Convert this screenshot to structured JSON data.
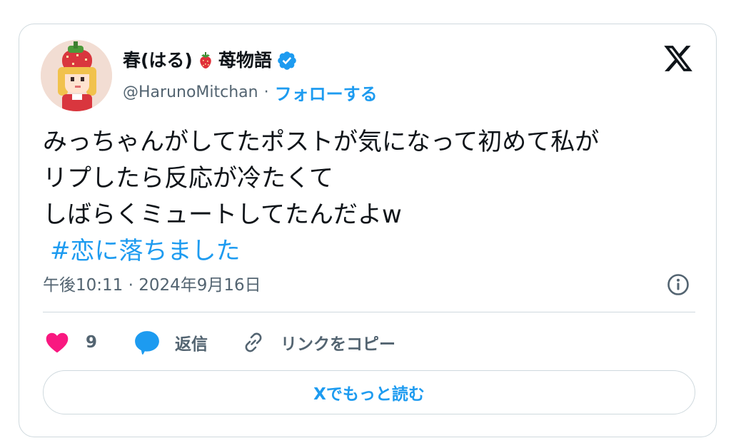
{
  "author": {
    "display_name": "春(はる)",
    "emoji": "strawberry-icon",
    "display_name_suffix": "苺物語",
    "handle": "@HarunoMitchan",
    "separator": "·",
    "follow_label": "フォローする",
    "verified": true
  },
  "tweet": {
    "text": "みっちゃんがしてたポストが気になって初めて私が\nリプしたら反応が冷たくて\nしばらくミュートしてたんだよw",
    "hashtag": "#恋に落ちました",
    "timestamp": "午後10:11 · 2024年9月16日"
  },
  "actions": {
    "like_count": "9",
    "reply_label": "返信",
    "copy_link_label": "リンクをコピー"
  },
  "footer": {
    "read_more_label": "Xでもっと読む"
  },
  "colors": {
    "accent": "#1d9bf0",
    "like": "#f91880",
    "secondary_text": "#536471",
    "border": "#cfd9de"
  }
}
